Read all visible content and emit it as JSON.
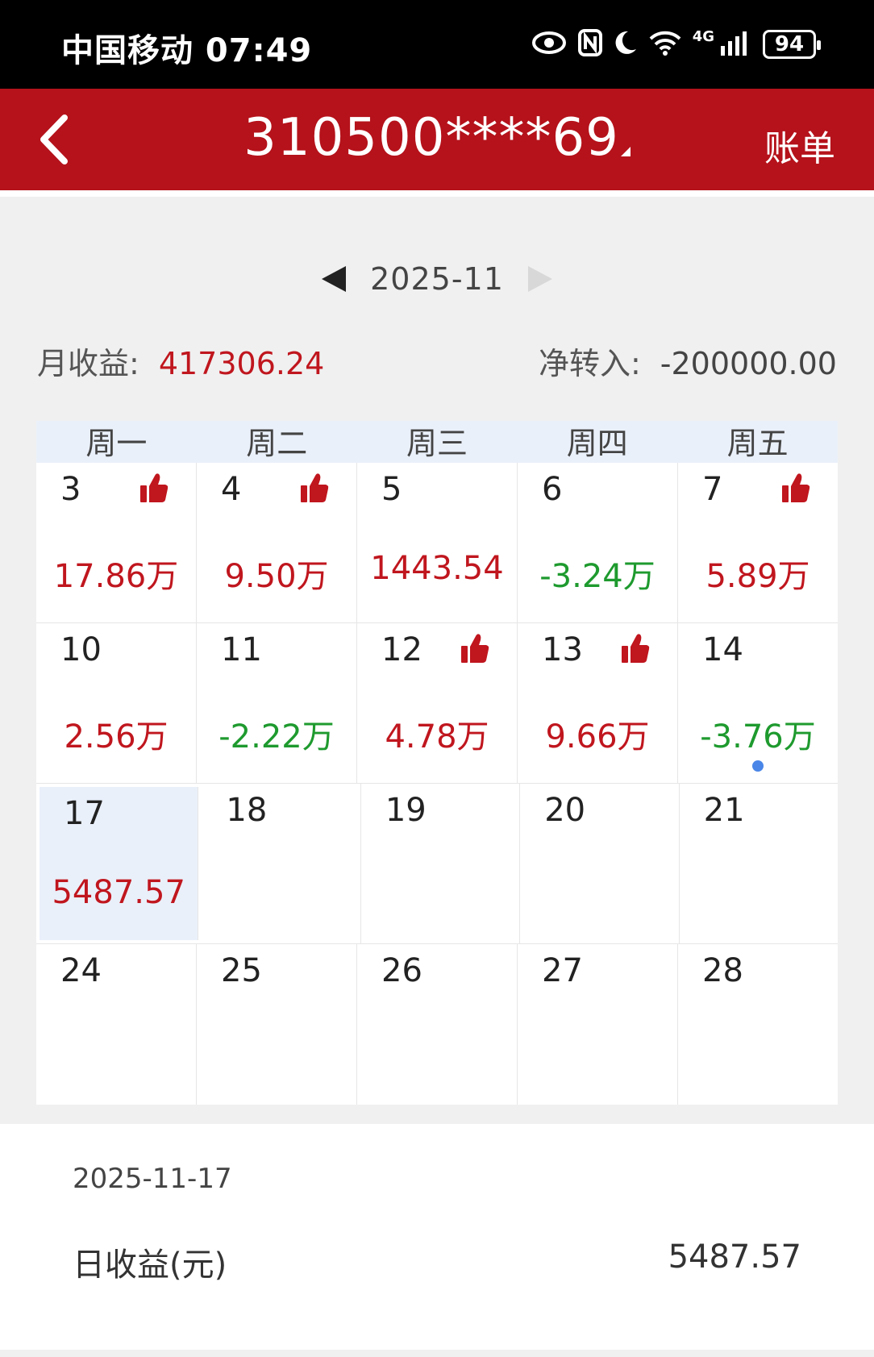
{
  "status_bar": {
    "carrier_time": "中国移动 07:49",
    "network": "4G",
    "battery": "94",
    "icons": [
      "eye-icon",
      "nfc-icon",
      "moon-icon",
      "wifi-icon",
      "signal-icon",
      "battery-icon"
    ]
  },
  "header": {
    "account": "310500****69",
    "bill_label": "账单",
    "bg_color": "#b5121b"
  },
  "month_nav": {
    "current": "2025-11"
  },
  "summary": {
    "monthly_label": "月收益:",
    "monthly_value": "417306.24",
    "net_in_label": "净转入:",
    "net_in_value": "-200000.00"
  },
  "calendar": {
    "weekdays": [
      "周一",
      "周二",
      "周三",
      "周四",
      "周五"
    ],
    "rows": [
      [
        {
          "day": "3",
          "amount": "17.86万",
          "sign": "pos",
          "thumb": true
        },
        {
          "day": "4",
          "amount": "9.50万",
          "sign": "pos",
          "thumb": true
        },
        {
          "day": "5",
          "amount": "1443.54",
          "sign": "pos",
          "thumb": false
        },
        {
          "day": "6",
          "amount": "-3.24万",
          "sign": "neg",
          "thumb": false
        },
        {
          "day": "7",
          "amount": "5.89万",
          "sign": "pos",
          "thumb": true
        }
      ],
      [
        {
          "day": "10",
          "amount": "2.56万",
          "sign": "pos",
          "thumb": false
        },
        {
          "day": "11",
          "amount": "-2.22万",
          "sign": "neg",
          "thumb": false
        },
        {
          "day": "12",
          "amount": "4.78万",
          "sign": "pos",
          "thumb": true
        },
        {
          "day": "13",
          "amount": "9.66万",
          "sign": "pos",
          "thumb": true
        },
        {
          "day": "14",
          "amount": "-3.76万",
          "sign": "neg",
          "thumb": false,
          "dot": true
        }
      ],
      [
        {
          "day": "17",
          "amount": "5487.57",
          "sign": "pos",
          "thumb": false,
          "selected": true
        },
        {
          "day": "18",
          "amount": "",
          "sign": "",
          "thumb": false
        },
        {
          "day": "19",
          "amount": "",
          "sign": "",
          "thumb": false
        },
        {
          "day": "20",
          "amount": "",
          "sign": "",
          "thumb": false
        },
        {
          "day": "21",
          "amount": "",
          "sign": "",
          "thumb": false
        }
      ],
      [
        {
          "day": "24",
          "amount": "",
          "sign": "",
          "thumb": false
        },
        {
          "day": "25",
          "amount": "",
          "sign": "",
          "thumb": false
        },
        {
          "day": "26",
          "amount": "",
          "sign": "",
          "thumb": false
        },
        {
          "day": "27",
          "amount": "",
          "sign": "",
          "thumb": false
        },
        {
          "day": "28",
          "amount": "",
          "sign": "",
          "thumb": false
        }
      ]
    ]
  },
  "detail": {
    "date": "2025-11-17",
    "label": "日收益(元)",
    "value": "5487.57"
  },
  "colors": {
    "positive": "#c0161e",
    "negative": "#1e9a2e",
    "selected_bg": "#eaf0fa"
  }
}
